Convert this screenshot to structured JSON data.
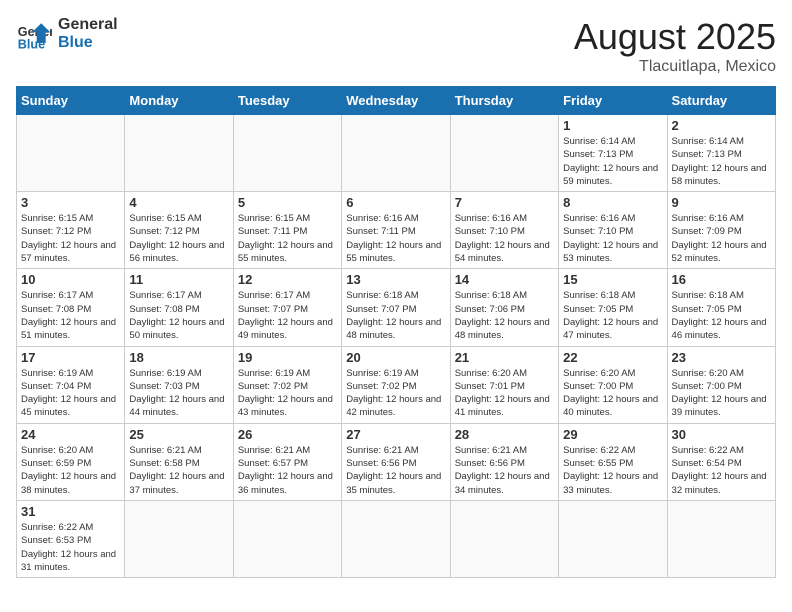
{
  "header": {
    "logo_general": "General",
    "logo_blue": "Blue",
    "month_year": "August 2025",
    "location": "Tlacuitlapa, Mexico"
  },
  "days_of_week": [
    "Sunday",
    "Monday",
    "Tuesday",
    "Wednesday",
    "Thursday",
    "Friday",
    "Saturday"
  ],
  "weeks": [
    {
      "days": [
        {
          "num": "",
          "info": ""
        },
        {
          "num": "",
          "info": ""
        },
        {
          "num": "",
          "info": ""
        },
        {
          "num": "",
          "info": ""
        },
        {
          "num": "",
          "info": ""
        },
        {
          "num": "1",
          "info": "Sunrise: 6:14 AM\nSunset: 7:13 PM\nDaylight: 12 hours\nand 59 minutes."
        },
        {
          "num": "2",
          "info": "Sunrise: 6:14 AM\nSunset: 7:13 PM\nDaylight: 12 hours\nand 58 minutes."
        }
      ]
    },
    {
      "days": [
        {
          "num": "3",
          "info": "Sunrise: 6:15 AM\nSunset: 7:12 PM\nDaylight: 12 hours\nand 57 minutes."
        },
        {
          "num": "4",
          "info": "Sunrise: 6:15 AM\nSunset: 7:12 PM\nDaylight: 12 hours\nand 56 minutes."
        },
        {
          "num": "5",
          "info": "Sunrise: 6:15 AM\nSunset: 7:11 PM\nDaylight: 12 hours\nand 55 minutes."
        },
        {
          "num": "6",
          "info": "Sunrise: 6:16 AM\nSunset: 7:11 PM\nDaylight: 12 hours\nand 55 minutes."
        },
        {
          "num": "7",
          "info": "Sunrise: 6:16 AM\nSunset: 7:10 PM\nDaylight: 12 hours\nand 54 minutes."
        },
        {
          "num": "8",
          "info": "Sunrise: 6:16 AM\nSunset: 7:10 PM\nDaylight: 12 hours\nand 53 minutes."
        },
        {
          "num": "9",
          "info": "Sunrise: 6:16 AM\nSunset: 7:09 PM\nDaylight: 12 hours\nand 52 minutes."
        }
      ]
    },
    {
      "days": [
        {
          "num": "10",
          "info": "Sunrise: 6:17 AM\nSunset: 7:08 PM\nDaylight: 12 hours\nand 51 minutes."
        },
        {
          "num": "11",
          "info": "Sunrise: 6:17 AM\nSunset: 7:08 PM\nDaylight: 12 hours\nand 50 minutes."
        },
        {
          "num": "12",
          "info": "Sunrise: 6:17 AM\nSunset: 7:07 PM\nDaylight: 12 hours\nand 49 minutes."
        },
        {
          "num": "13",
          "info": "Sunrise: 6:18 AM\nSunset: 7:07 PM\nDaylight: 12 hours\nand 48 minutes."
        },
        {
          "num": "14",
          "info": "Sunrise: 6:18 AM\nSunset: 7:06 PM\nDaylight: 12 hours\nand 48 minutes."
        },
        {
          "num": "15",
          "info": "Sunrise: 6:18 AM\nSunset: 7:05 PM\nDaylight: 12 hours\nand 47 minutes."
        },
        {
          "num": "16",
          "info": "Sunrise: 6:18 AM\nSunset: 7:05 PM\nDaylight: 12 hours\nand 46 minutes."
        }
      ]
    },
    {
      "days": [
        {
          "num": "17",
          "info": "Sunrise: 6:19 AM\nSunset: 7:04 PM\nDaylight: 12 hours\nand 45 minutes."
        },
        {
          "num": "18",
          "info": "Sunrise: 6:19 AM\nSunset: 7:03 PM\nDaylight: 12 hours\nand 44 minutes."
        },
        {
          "num": "19",
          "info": "Sunrise: 6:19 AM\nSunset: 7:02 PM\nDaylight: 12 hours\nand 43 minutes."
        },
        {
          "num": "20",
          "info": "Sunrise: 6:19 AM\nSunset: 7:02 PM\nDaylight: 12 hours\nand 42 minutes."
        },
        {
          "num": "21",
          "info": "Sunrise: 6:20 AM\nSunset: 7:01 PM\nDaylight: 12 hours\nand 41 minutes."
        },
        {
          "num": "22",
          "info": "Sunrise: 6:20 AM\nSunset: 7:00 PM\nDaylight: 12 hours\nand 40 minutes."
        },
        {
          "num": "23",
          "info": "Sunrise: 6:20 AM\nSunset: 7:00 PM\nDaylight: 12 hours\nand 39 minutes."
        }
      ]
    },
    {
      "days": [
        {
          "num": "24",
          "info": "Sunrise: 6:20 AM\nSunset: 6:59 PM\nDaylight: 12 hours\nand 38 minutes."
        },
        {
          "num": "25",
          "info": "Sunrise: 6:21 AM\nSunset: 6:58 PM\nDaylight: 12 hours\nand 37 minutes."
        },
        {
          "num": "26",
          "info": "Sunrise: 6:21 AM\nSunset: 6:57 PM\nDaylight: 12 hours\nand 36 minutes."
        },
        {
          "num": "27",
          "info": "Sunrise: 6:21 AM\nSunset: 6:56 PM\nDaylight: 12 hours\nand 35 minutes."
        },
        {
          "num": "28",
          "info": "Sunrise: 6:21 AM\nSunset: 6:56 PM\nDaylight: 12 hours\nand 34 minutes."
        },
        {
          "num": "29",
          "info": "Sunrise: 6:22 AM\nSunset: 6:55 PM\nDaylight: 12 hours\nand 33 minutes."
        },
        {
          "num": "30",
          "info": "Sunrise: 6:22 AM\nSunset: 6:54 PM\nDaylight: 12 hours\nand 32 minutes."
        }
      ]
    },
    {
      "days": [
        {
          "num": "31",
          "info": "Sunrise: 6:22 AM\nSunset: 6:53 PM\nDaylight: 12 hours\nand 31 minutes."
        },
        {
          "num": "",
          "info": ""
        },
        {
          "num": "",
          "info": ""
        },
        {
          "num": "",
          "info": ""
        },
        {
          "num": "",
          "info": ""
        },
        {
          "num": "",
          "info": ""
        },
        {
          "num": "",
          "info": ""
        }
      ]
    }
  ]
}
